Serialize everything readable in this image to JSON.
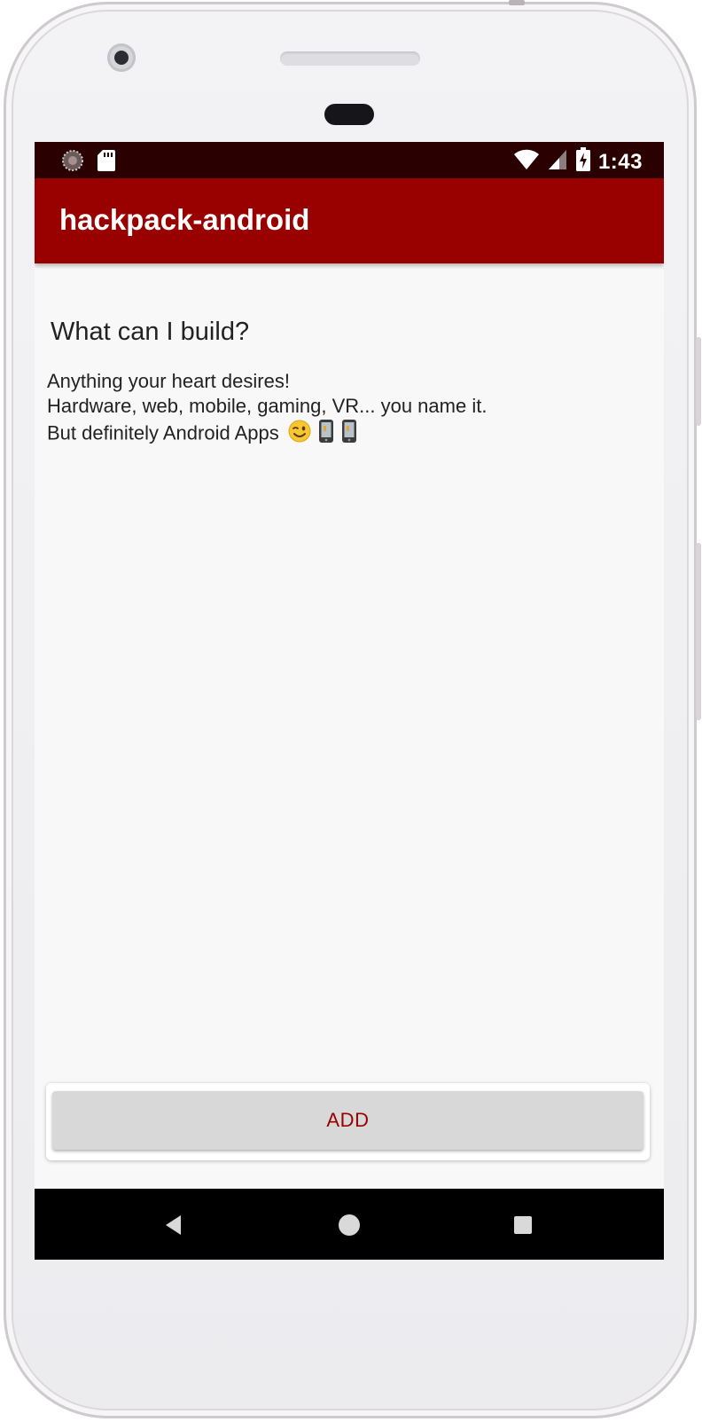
{
  "status_bar": {
    "time": "1:43",
    "left_icons": [
      "sync-indicator-icon",
      "sd-card-icon"
    ],
    "right_icons": [
      "wifi-icon",
      "cell-signal-icon",
      "battery-charging-icon"
    ]
  },
  "app_bar": {
    "title": "hackpack-android"
  },
  "content": {
    "heading": "What can I build?",
    "body_lines": [
      "Anything your heart desires!",
      "Hardware, web, mobile, gaming, VR... you name it.",
      "But definitely Android Apps"
    ],
    "body_emojis": [
      "winking-face-icon",
      "mobile-phone-icon",
      "mobile-phone-icon"
    ]
  },
  "actions": {
    "add_label": "ADD"
  },
  "nav_bar": {
    "buttons": [
      "back-icon",
      "home-icon",
      "recents-icon"
    ]
  },
  "colors": {
    "status_bar": "#2a0000",
    "app_bar": "#990000",
    "accent_text": "#990000",
    "background": "#f8f8f8",
    "button_bg": "#d8d8d8"
  }
}
